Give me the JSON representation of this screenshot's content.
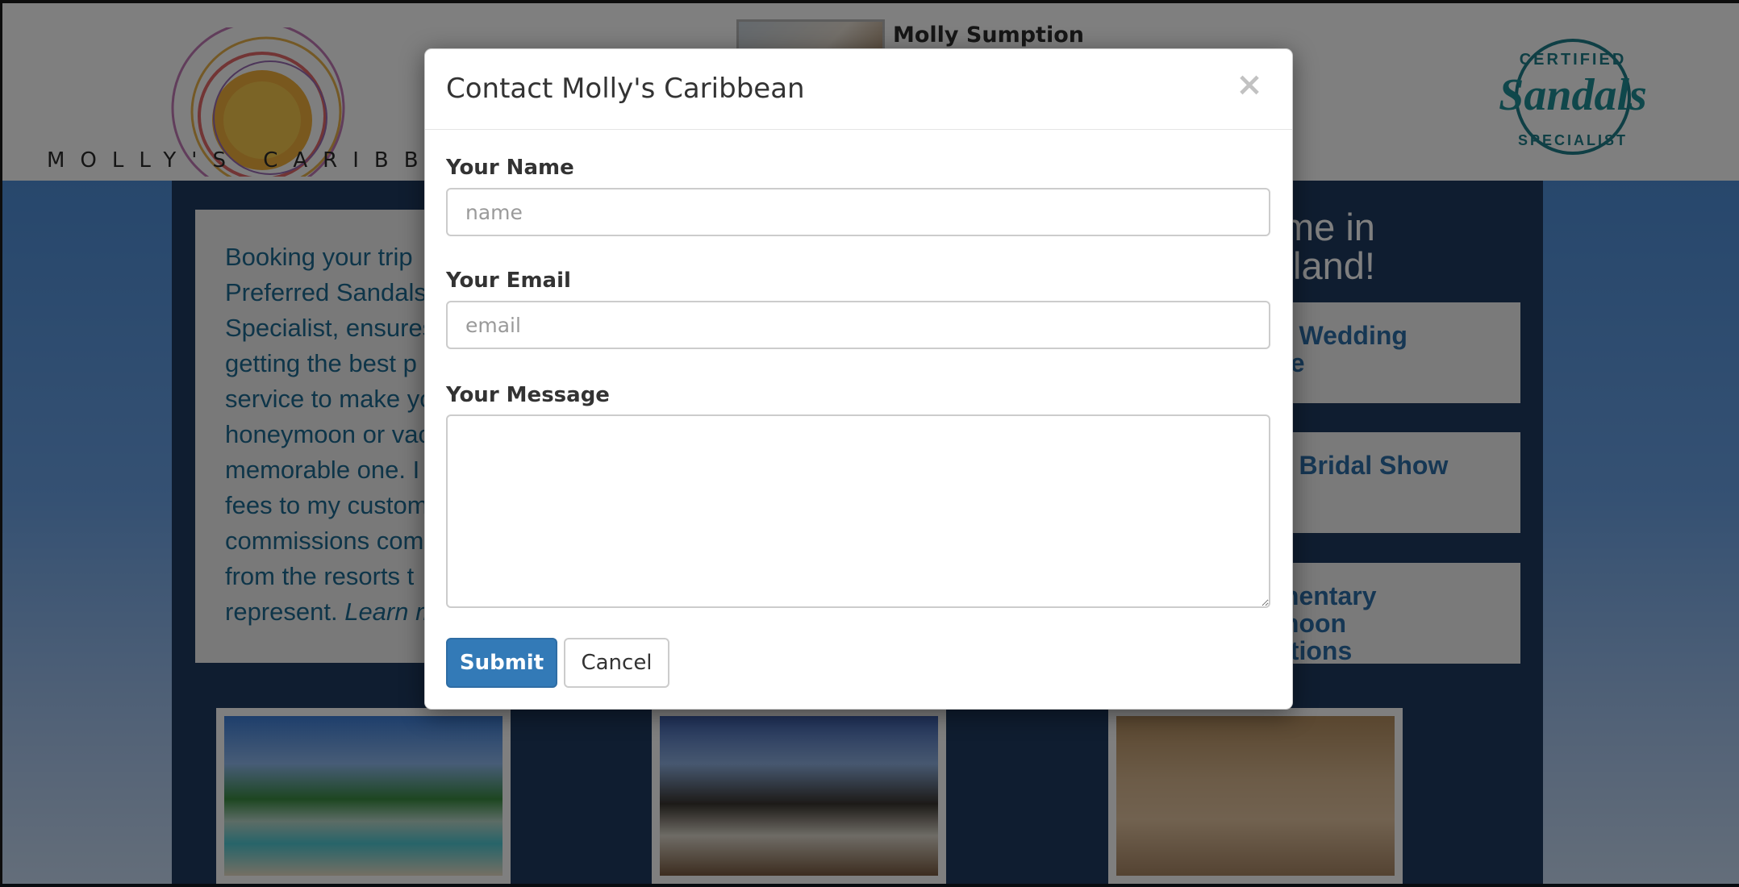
{
  "header": {
    "logo_text": "MOLLY'S CARIBBEAN",
    "agent_name": "Molly Sumption",
    "badge": {
      "top_text": "CERTIFIED",
      "brand": "Sandals",
      "bottom_text": "SPECIALIST"
    }
  },
  "intro": {
    "lines": [
      "Booking your trip",
      "Preferred Sandals",
      "Specialist, ensures",
      "getting the best p",
      "service to make yo",
      "honeymoon or vac",
      "memorable one. I",
      "fees to my custom",
      "commissions com",
      "from the resorts t"
    ],
    "last_line": "represent.",
    "learn_more": "Learn m"
  },
  "promo": {
    "title_line1": "me in",
    "title_line2": "tland!",
    "items": [
      {
        "line1": "d Wedding",
        "line2": "se"
      },
      {
        "line1": "d Bridal Show",
        "line2": ""
      },
      {
        "line1": "mentary",
        "line2": "moon",
        "line3": "ations"
      }
    ]
  },
  "modal": {
    "title": "Contact Molly's Caribbean",
    "close_label": "×",
    "name_label": "Your Name",
    "name_placeholder": "name",
    "email_label": "Your Email",
    "email_placeholder": "email",
    "message_label": "Your Message",
    "submit_label": "Submit",
    "cancel_label": "Cancel"
  },
  "colors": {
    "primary_button": "#337ab7",
    "navy_panel": "#1f3a60",
    "intro_text": "#1d6a92",
    "promo_text": "#2d6fa8"
  }
}
